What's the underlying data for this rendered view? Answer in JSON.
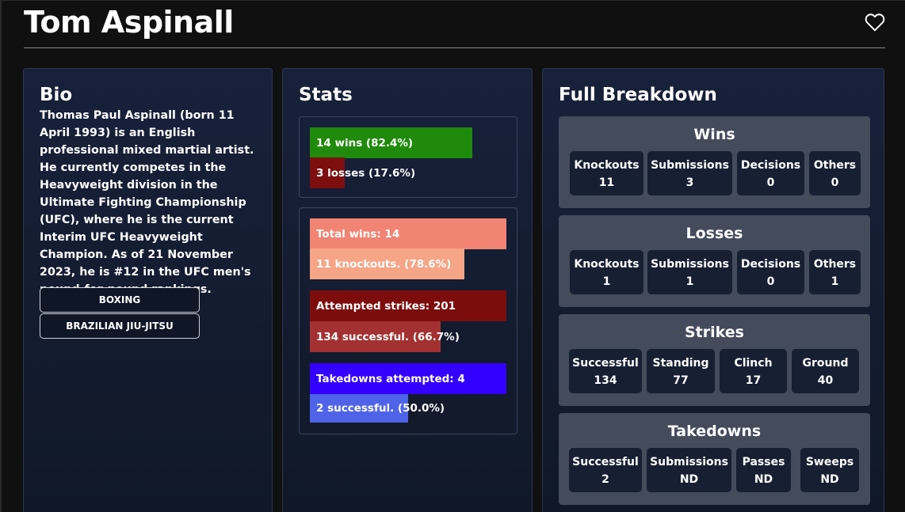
{
  "header": {
    "title": "Tom Aspinall"
  },
  "bio": {
    "title": "Bio",
    "text": "Thomas Paul Aspinall (born 11 April 1993) is an English professional mixed martial artist. He currently competes in the Heavyweight division in the Ultimate Fighting Championship (UFC), where he is the current Interim UFC Heavyweight Champion. As of 21 November 2023, he is #12 in the UFC men's pound-for-pound rankings.",
    "styles": [
      "BOXING",
      "BRAZILIAN JIU-JITSU"
    ]
  },
  "stats": {
    "title": "Stats",
    "record": [
      {
        "label": "14 wins (82.4%)",
        "fraction": 0.824,
        "color": "#1f8a0b"
      },
      {
        "label": "3 losses (17.6%)",
        "fraction": 0.176,
        "color": "#7d0e0e"
      }
    ],
    "details": [
      {
        "label": "Total wins: 14",
        "fraction": 1.0,
        "color": "#f28474"
      },
      {
        "label": "11 knockouts. (78.6%)",
        "fraction": 0.786,
        "color": "#f6a586"
      },
      {
        "label": "Attempted strikes: 201",
        "fraction": 1.0,
        "color": "#7d0d0d"
      },
      {
        "label": "134 successful. (66.7%)",
        "fraction": 0.667,
        "color": "#a33131"
      },
      {
        "label": "Takedowns attempted: 4",
        "fraction": 1.0,
        "color": "#3300ff"
      },
      {
        "label": "2 successful. (50.0%)",
        "fraction": 0.5,
        "color": "#4f63e8"
      }
    ]
  },
  "breakdown": {
    "title": "Full Breakdown",
    "sections": [
      {
        "title": "Wins",
        "cells": [
          {
            "label": "Knockouts",
            "value": "11"
          },
          {
            "label": "Submissions",
            "value": "3"
          },
          {
            "label": "Decisions",
            "value": "0"
          },
          {
            "label": "Others",
            "value": "0"
          }
        ]
      },
      {
        "title": "Losses",
        "cells": [
          {
            "label": "Knockouts",
            "value": "1"
          },
          {
            "label": "Submissions",
            "value": "1"
          },
          {
            "label": "Decisions",
            "value": "0"
          },
          {
            "label": "Others",
            "value": "1"
          }
        ]
      },
      {
        "title": "Strikes",
        "cells": [
          {
            "label": "Successful",
            "value": "134"
          },
          {
            "label": "Standing",
            "value": "77"
          },
          {
            "label": "Clinch",
            "value": "17"
          },
          {
            "label": "Ground",
            "value": "40"
          }
        ]
      },
      {
        "title": "Takedowns",
        "cells": [
          {
            "label": "Successful",
            "value": "2"
          },
          {
            "label": "Submissions",
            "value": "ND"
          },
          {
            "label": "Passes",
            "value": "ND"
          },
          {
            "label": "Sweeps",
            "value": "ND"
          }
        ]
      }
    ]
  },
  "icons": {
    "favorite": "heart-outline-icon"
  }
}
